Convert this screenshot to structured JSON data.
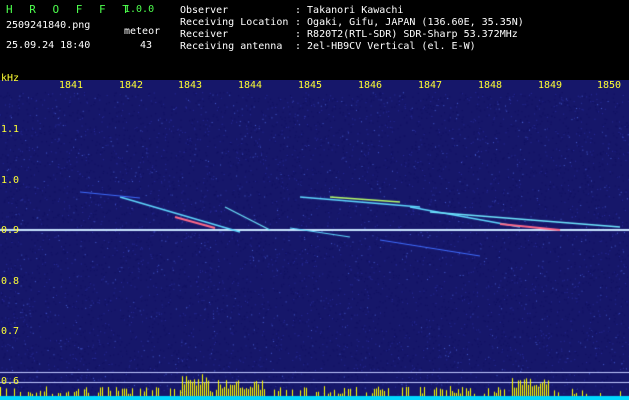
{
  "app": {
    "title": "H R O F F T",
    "version": "1.0.0",
    "filename": "2509241840.png",
    "datetime": "25.09.24 18:40",
    "mode": "meteor",
    "count": "43"
  },
  "info": {
    "labels": [
      "Observer",
      "Receiving Location",
      "Receiver",
      "Receiving antenna"
    ],
    "values": [
      ": Takanori Kawachi",
      ": Ogaki, Gifu, JAPAN (136.60E, 35.35N)",
      ": R820T2(RTL-SDR) SDR-Sharp 53.372MHz",
      ": 2el-HB9CV Vertical (el. E-W)"
    ]
  },
  "axes": {
    "y_unit": "kHz",
    "x_ticks": [
      "1841",
      "1842",
      "1843",
      "1844",
      "1845",
      "1846",
      "1847",
      "1848",
      "1849",
      "1850"
    ],
    "y_ticks": [
      "1.1",
      "1.0",
      "0.9",
      "0.8",
      "0.7",
      "0.6"
    ]
  },
  "colors": {
    "background": "#16176a",
    "carrier": "#c8e6ff",
    "bars": "#ffff00",
    "label_green": "#4dff4d",
    "label_yellow": "#ffff33"
  }
}
